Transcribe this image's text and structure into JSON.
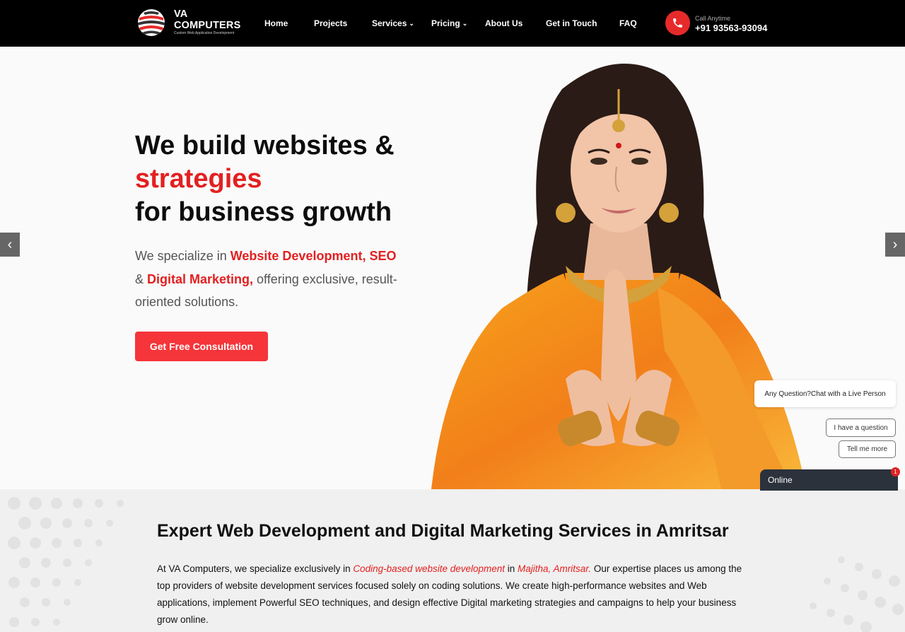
{
  "header": {
    "logo_title": "VA COMPUTERS",
    "logo_tagline": "Custom Web Application Development",
    "nav": [
      {
        "label": "Home",
        "has_dropdown": false
      },
      {
        "label": "Projects",
        "has_dropdown": false
      },
      {
        "label": "Services",
        "has_dropdown": true
      },
      {
        "label": "Pricing",
        "has_dropdown": true
      },
      {
        "label": "About Us",
        "has_dropdown": false
      },
      {
        "label": "Get in Touch",
        "has_dropdown": false
      },
      {
        "label": "FAQ",
        "has_dropdown": false
      }
    ],
    "call_label": "Call Anytime",
    "phone": "+91 93563-93094",
    "phone_icon": "phone-icon"
  },
  "hero": {
    "headline_line1": "We build websites &",
    "headline_line2": "strategies",
    "headline_line3": "for business growth",
    "lead_part1": "We specialize in ",
    "lead_hl1": "Website Development, SEO",
    "lead_part2": "& ",
    "lead_hl2": "Digital Marketing,",
    "lead_part3": " offering exclusive, result-oriented solutions.",
    "cta_label": "Get Free Consultation",
    "prev_arrow": "‹",
    "next_arrow": "›"
  },
  "chat": {
    "bubble_text": "Any Question?Chat with a Live Person",
    "option1": "I have a question",
    "option2": "Tell me more",
    "status": "Online",
    "badge_count": "1"
  },
  "section": {
    "title": "Expert Web Development and Digital Marketing Services in Amritsar",
    "body_part1": "At VA Computers, we specialize exclusively in ",
    "body_link1": "Coding-based website development",
    "body_part2": " in ",
    "body_link2": "Majitha, Amritsar.",
    "body_part3": " Our expertise places us among the top providers of website development services focused solely on coding solutions. We create high-performance websites and Web applications, implement Powerful SEO techniques, and design effective Digital marketing strategies and campaigns to help your business grow online."
  },
  "colors": {
    "accent": "#e32020",
    "header_bg": "#000000",
    "cta_bg": "#f5353a",
    "chat_bar": "#2b323c"
  }
}
